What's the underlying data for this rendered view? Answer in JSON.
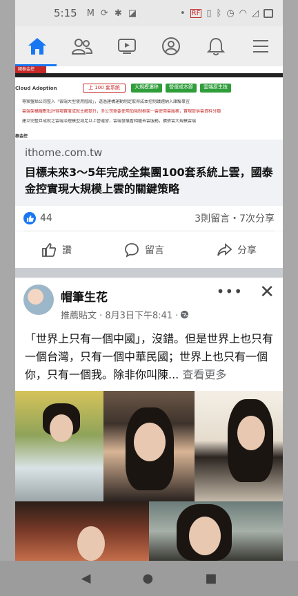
{
  "status_bar": {
    "time": "5:15",
    "left_icons": [
      "gmail-icon",
      "sync-icon",
      "android-icon",
      "app-icon"
    ],
    "right_icons": [
      "dot",
      "rf-icon",
      "vibrate-icon",
      "bluetooth-off-icon",
      "alarm-icon",
      "wifi-icon",
      "signal-off-icon",
      "battery-icon"
    ]
  },
  "nav": {
    "tabs": [
      "home-icon",
      "friends-icon",
      "video-icon",
      "profile-icon",
      "notifications-icon",
      "menu-icon"
    ],
    "active": "home-icon",
    "accent": "#1877f2"
  },
  "post1": {
    "hero": {
      "top_left_label": "國泰金控",
      "cloud_label": "Cloud Adoption",
      "red_pill": "上 100 套系統",
      "green_pills": [
        "大規模遷移",
        "營運成本節",
        "雲端原生技"
      ],
      "lines": [
        "專案盤點公司整入「雲端大型使用階段」，透過建構運動制定取得成本控制議題納入諸驗事宜",
        "雲端架構複數批評得項實度成就主解提升，多公司需要使用加強制框架一雲使用雲服務，實現提供雲資料分類",
        "建立完整且成就之雲端治理模型減足以上營運發，雲端發展看相繼去雲服務，擴張雲大規模雲端"
      ],
      "source_label": "泰金控"
    },
    "link": {
      "domain": "ithome.com.tw",
      "headline": "目標未來3～5年完成全集團100套系統上雲，國泰金控實現大規模上雲的關鍵策略"
    },
    "reactions": {
      "count": "44",
      "meta": "3則留言・7次分享"
    },
    "actions": {
      "like": "讚",
      "comment": "留言",
      "share": "分享"
    }
  },
  "post2": {
    "author": "帽筆生花",
    "meta": "推薦貼文 · 8月3日下午8:41 ·",
    "more": "•••",
    "close": "✕",
    "body": "「世界上只有一個中國」，沒錯。但是世界上也只有一個台灣，只有一個中華民國；世界上也只有一個你，只有一個我。除非你叫陳...",
    "see_more": "查看更多"
  },
  "system_nav": {
    "back": "◀",
    "home": "●",
    "recents": "■"
  }
}
